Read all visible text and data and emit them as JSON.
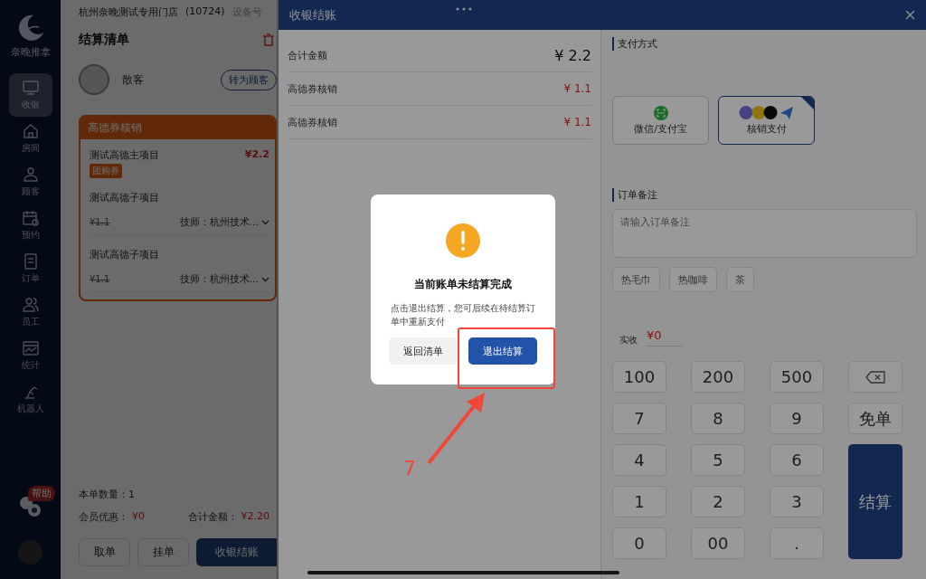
{
  "sidebar": {
    "logo_text": "奈晚推拿",
    "items": [
      {
        "label": "收银",
        "selected": true
      },
      {
        "label": "房间",
        "selected": false
      },
      {
        "label": "顾客",
        "selected": false
      },
      {
        "label": "预约",
        "selected": false
      },
      {
        "label": "订单",
        "selected": false
      },
      {
        "label": "员工",
        "selected": false
      },
      {
        "label": "统计",
        "selected": false
      },
      {
        "label": "机器人",
        "selected": false
      }
    ],
    "help_badge": "帮助"
  },
  "order_panel": {
    "store": "杭州奈晚测试专用门店",
    "store_code": "(10724)",
    "device_label": "设备号",
    "title": "结算清单",
    "customer": "散客",
    "customer_button": "转为顾客",
    "group": {
      "title": "高德券核销",
      "main_item": {
        "name": "测试高德主项目",
        "price": "¥2.2",
        "tag": "团购券"
      },
      "sub_items": [
        {
          "name": "测试高德子项目",
          "price": "¥1.1",
          "technician": "技师：杭州技术..."
        },
        {
          "name": "测试高德子项目",
          "price": "¥1.1",
          "technician": "技师：杭州技术..."
        }
      ]
    },
    "count_label": "本单数量：1",
    "discount_label": "会员优惠：",
    "discount": "¥0",
    "total_label": "合计金额：",
    "total": "¥2.20",
    "buttons": [
      {
        "label": "取单",
        "kind": "plain"
      },
      {
        "label": "挂单",
        "kind": "plain"
      },
      {
        "label": "收银结账",
        "kind": "primary"
      }
    ]
  },
  "drawer": {
    "title": "收银结账",
    "summary": [
      {
        "label": "合计金额",
        "value": "¥ 2.2",
        "kind": "total"
      },
      {
        "label": "高德券核销",
        "value": "¥ 1.1",
        "kind": "deduction"
      },
      {
        "label": "高德券核销",
        "value": "¥ 1.1",
        "kind": "deduction"
      }
    ],
    "payment_title": "支付方式",
    "payments": [
      {
        "label": "微信/支付宝",
        "kind": "scan",
        "selected": false
      },
      {
        "label": "核销支付",
        "kind": "voucher",
        "selected": true
      }
    ],
    "note_title": "订单备注",
    "note_placeholder": "请输入订单备注",
    "note_chips": [
      "热毛巾",
      "热咖啡",
      "茶"
    ],
    "received_label": "实收",
    "received": "¥0",
    "keys": [
      {
        "label": "100",
        "kind": "text"
      },
      {
        "label": "200",
        "kind": "text"
      },
      {
        "label": "500",
        "kind": "text"
      },
      {
        "kind": "backspace"
      },
      {
        "label": "7",
        "kind": "text"
      },
      {
        "label": "8",
        "kind": "text"
      },
      {
        "label": "9",
        "kind": "text"
      },
      {
        "label": "免单",
        "kind": "text"
      },
      {
        "label": "4",
        "kind": "text"
      },
      {
        "label": "5",
        "kind": "text"
      },
      {
        "label": "6",
        "kind": "text"
      },
      {
        "label": "1",
        "kind": "text"
      },
      {
        "label": "2",
        "kind": "text"
      },
      {
        "label": "3",
        "kind": "text"
      },
      {
        "label": "结算",
        "kind": "submit"
      },
      {
        "label": "0",
        "kind": "text"
      },
      {
        "label": "00",
        "kind": "text"
      },
      {
        "label": ".",
        "kind": "text"
      }
    ]
  },
  "dialog": {
    "title": "当前账单未结算完成",
    "message": "点击退出结算，您可后续在待结算订单中重新支付",
    "buttons": [
      {
        "label": "返回清单",
        "kind": "secondary"
      },
      {
        "label": "退出结算",
        "kind": "primary"
      }
    ]
  },
  "annotation": {
    "label": "7"
  }
}
